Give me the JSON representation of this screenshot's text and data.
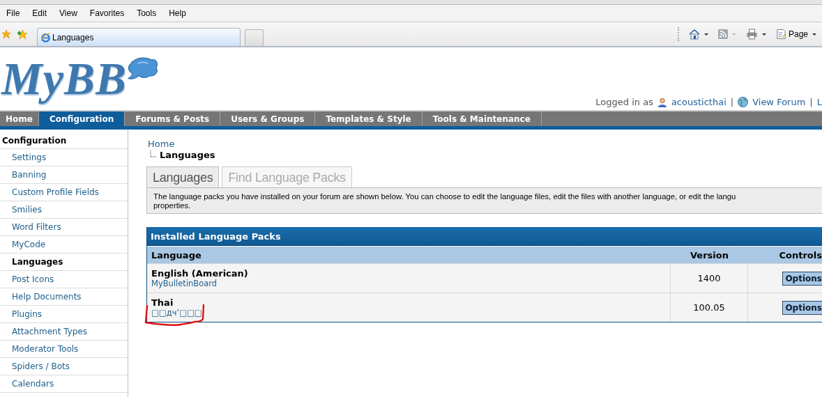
{
  "browser": {
    "menu": [
      "File",
      "Edit",
      "View",
      "Favorites",
      "Tools",
      "Help"
    ],
    "tab_title": "Languages",
    "toolbar_page": "Page"
  },
  "header": {
    "logo": "MyBB",
    "logged_in_label": "Logged in as",
    "user": "acousticthai",
    "separator": "|",
    "links": [
      "View Forum",
      "L"
    ]
  },
  "nav": [
    {
      "label": "Home",
      "selected": false
    },
    {
      "label": "Configuration",
      "selected": true
    },
    {
      "label": "Forums & Posts",
      "selected": false
    },
    {
      "label": "Users & Groups",
      "selected": false
    },
    {
      "label": "Templates & Style",
      "selected": false
    },
    {
      "label": "Tools & Maintenance",
      "selected": false
    }
  ],
  "sidebar": {
    "title": "Configuration",
    "items": [
      {
        "label": "Settings",
        "selected": false
      },
      {
        "label": "Banning",
        "selected": false
      },
      {
        "label": "Custom Profile Fields",
        "selected": false
      },
      {
        "label": "Smilies",
        "selected": false
      },
      {
        "label": "Word Filters",
        "selected": false
      },
      {
        "label": "MyCode",
        "selected": false
      },
      {
        "label": "Languages",
        "selected": true
      },
      {
        "label": "Post Icons",
        "selected": false
      },
      {
        "label": "Help Documents",
        "selected": false
      },
      {
        "label": "Plugins",
        "selected": false
      },
      {
        "label": "Attachment Types",
        "selected": false
      },
      {
        "label": "Moderator Tools",
        "selected": false
      },
      {
        "label": "Spiders / Bots",
        "selected": false
      },
      {
        "label": "Calendars",
        "selected": false
      }
    ]
  },
  "breadcrumb": {
    "home": "Home",
    "current": "Languages"
  },
  "tabs": [
    {
      "label": "Languages",
      "selected": true
    },
    {
      "label": "Find Language Packs",
      "selected": false
    }
  ],
  "description_lines": [
    "The language packs you have installed on your forum are shown below. You can choose to edit the language files, edit the files with another language, or edit the langu",
    "properties."
  ],
  "table": {
    "title": "Installed Language Packs",
    "columns": [
      "Language",
      "Version",
      "Controls"
    ],
    "rows": [
      {
        "name": "English (American)",
        "author": "MyBulletinBoard",
        "version": "1400",
        "control": "Options",
        "annotated": false
      },
      {
        "name": "Thai",
        "author": "□□дч’□□□",
        "version": "100.05",
        "control": "Options",
        "annotated": true
      }
    ]
  }
}
